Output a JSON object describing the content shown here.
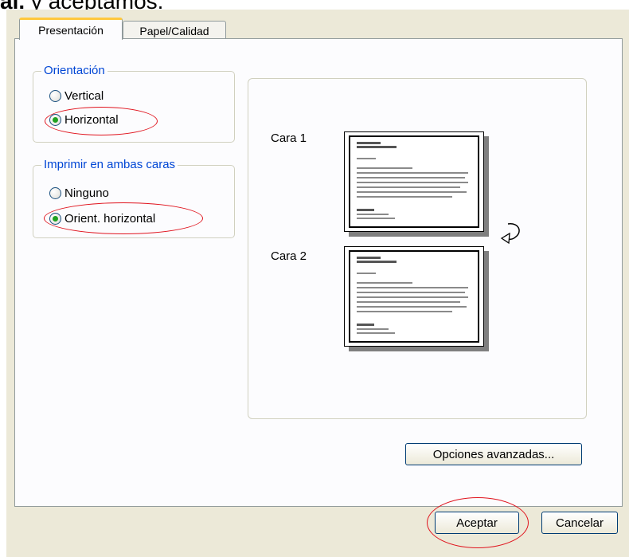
{
  "background_text": {
    "bold": "al.",
    "rest": " y aceptamos."
  },
  "tabs": [
    {
      "label": "Presentación",
      "active": true
    },
    {
      "label": "Papel/Calidad",
      "active": false
    }
  ],
  "orientacion": {
    "title": "Orientación",
    "options": [
      {
        "label": "Vertical",
        "checked": false
      },
      {
        "label": "Horizontal",
        "checked": true
      }
    ]
  },
  "duplex": {
    "title": "Imprimir en ambas caras",
    "options": [
      {
        "label": "Ninguno",
        "checked": false
      },
      {
        "label": "Orient. horizontal",
        "checked": true
      }
    ]
  },
  "preview": {
    "page1_label": "Cara 1",
    "page2_label": "Cara 2",
    "flip_icon": "rotate-arrow-icon"
  },
  "buttons": {
    "advanced": "Opciones avanzadas...",
    "ok": "Aceptar",
    "cancel": "Cancelar"
  },
  "colors": {
    "dialog_bg": "#ece9d8",
    "panel_bg": "#fcfcfe",
    "group_title": "#0046d5",
    "highlight_oval": "#e0141e",
    "radio_dot": "#21a121"
  }
}
